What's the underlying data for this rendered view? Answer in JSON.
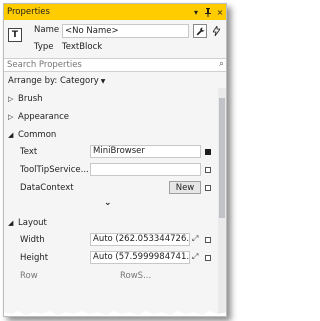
{
  "window": {
    "title": "Properties",
    "pin_glyph": "▾ ╤",
    "close_glyph": "×"
  },
  "header": {
    "name_label": "Name",
    "name_value": "<No Name>",
    "type_label": "Type",
    "type_value": "TextBlock",
    "type_icon_glyph": "T"
  },
  "search": {
    "placeholder": "Search Properties"
  },
  "arrange": {
    "label": "Arrange by: Category",
    "caret": "▼"
  },
  "categories": {
    "brush": "Brush",
    "appearance": "Appearance",
    "common": "Common",
    "layout": "Layout"
  },
  "common": {
    "text_label": "Text",
    "text_value": "MiniBrowser",
    "tooltip_label": "ToolTipService...",
    "tooltip_value": "",
    "datacontext_label": "DataContext",
    "new_button": "New"
  },
  "layout": {
    "width_label": "Width",
    "width_value": "Auto (262.053344726...",
    "height_label": "Height",
    "height_value": "Auto (57.5999984741...",
    "row_label": "Row",
    "rowspan_label": "RowS..."
  }
}
